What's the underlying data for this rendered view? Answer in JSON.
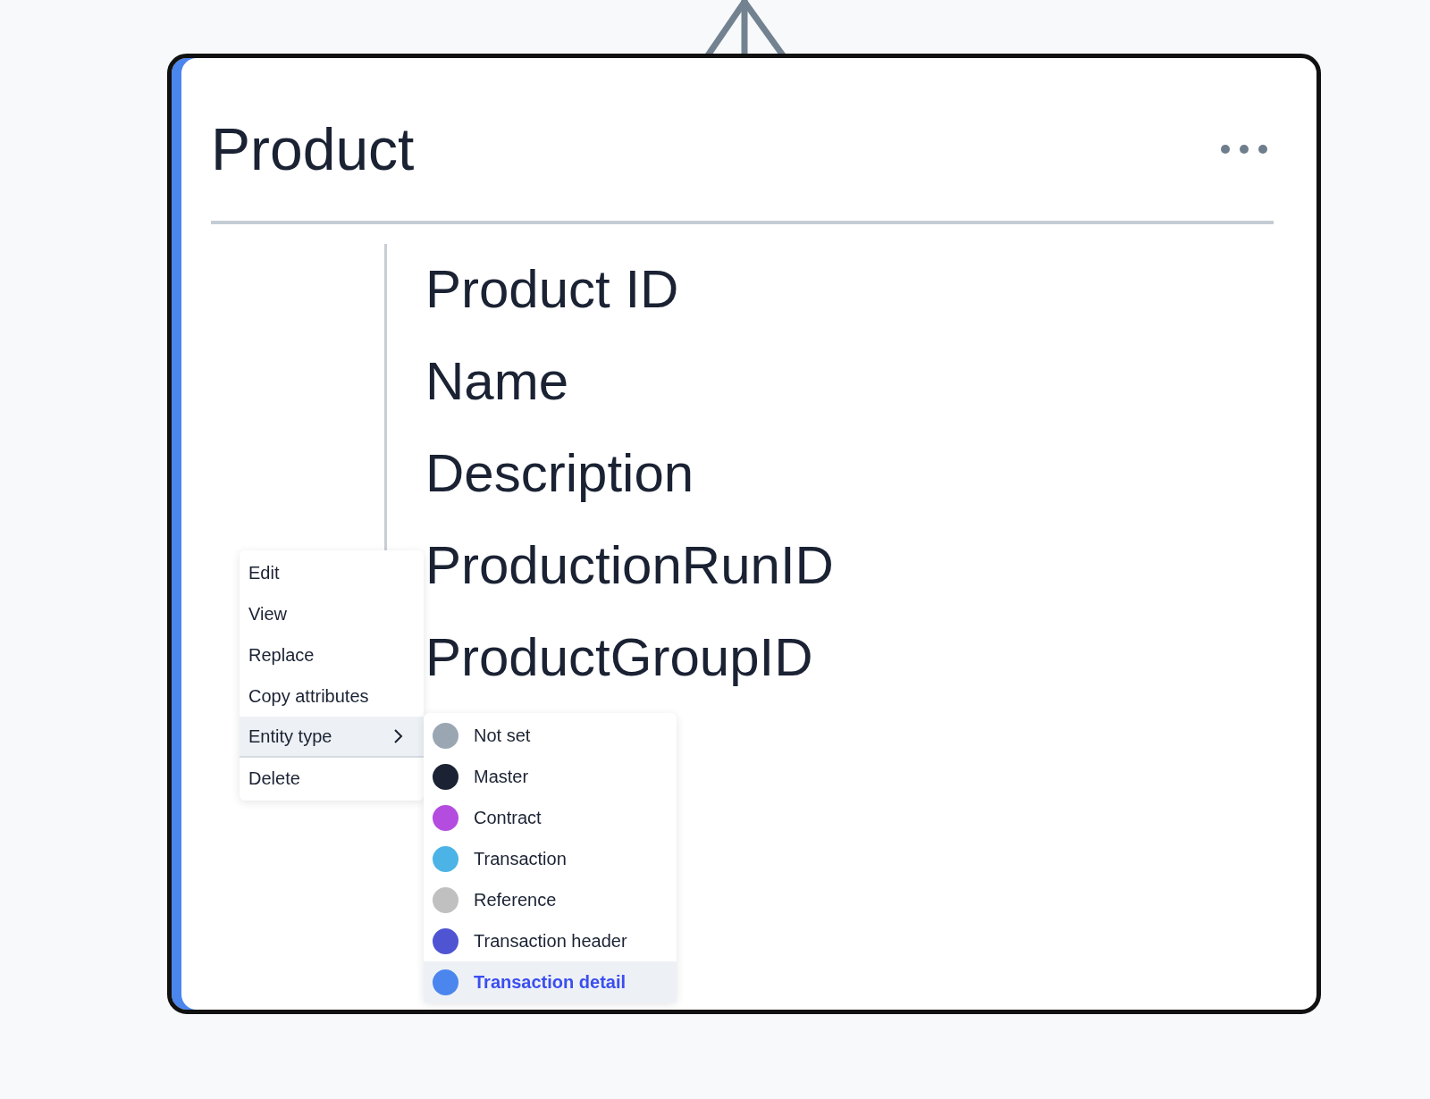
{
  "entity": {
    "title": "Product",
    "attributes": [
      {
        "label": "Product ID"
      },
      {
        "label": "Name"
      },
      {
        "label": "Description"
      },
      {
        "label": "ProductionRunID"
      },
      {
        "label": "ProductGroupID"
      }
    ]
  },
  "context_menu": {
    "items": [
      {
        "label": "Edit",
        "kind": "action",
        "selected": false
      },
      {
        "label": "View",
        "kind": "action",
        "selected": false
      },
      {
        "label": "Replace",
        "kind": "action",
        "selected": false
      },
      {
        "label": "Copy attributes",
        "kind": "action",
        "selected": false
      },
      {
        "label": "Entity type",
        "kind": "submenu",
        "selected": true
      },
      {
        "label": "Delete",
        "kind": "action",
        "selected": false
      }
    ]
  },
  "entity_type_menu": {
    "items": [
      {
        "label": "Not set",
        "color": "#9aa6b2",
        "selected": false
      },
      {
        "label": "Master",
        "color": "#1a2233",
        "selected": false
      },
      {
        "label": "Contract",
        "color": "#b44ddf",
        "selected": false
      },
      {
        "label": "Transaction",
        "color": "#4cb3e6",
        "selected": false
      },
      {
        "label": "Reference",
        "color": "#c0c0c0",
        "selected": false
      },
      {
        "label": "Transaction header",
        "color": "#4f55d2",
        "selected": false
      },
      {
        "label": "Transaction detail",
        "color": "#4a86ee",
        "selected": true
      }
    ]
  }
}
